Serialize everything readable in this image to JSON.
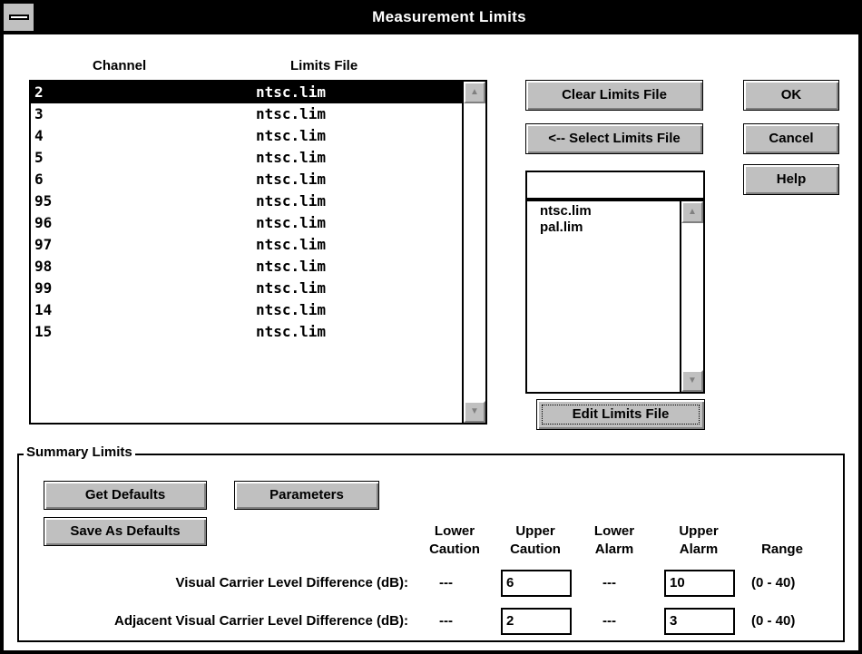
{
  "window": {
    "title": "Measurement Limits"
  },
  "channel_list": {
    "headers": {
      "channel": "Channel",
      "limits_file": "Limits File"
    },
    "rows": [
      {
        "channel": "2",
        "limits_file": "ntsc.lim",
        "selected": true
      },
      {
        "channel": "3",
        "limits_file": "ntsc.lim"
      },
      {
        "channel": "4",
        "limits_file": "ntsc.lim"
      },
      {
        "channel": "5",
        "limits_file": "ntsc.lim"
      },
      {
        "channel": "6",
        "limits_file": "ntsc.lim"
      },
      {
        "channel": "95",
        "limits_file": "ntsc.lim"
      },
      {
        "channel": "96",
        "limits_file": "ntsc.lim"
      },
      {
        "channel": "97",
        "limits_file": "ntsc.lim"
      },
      {
        "channel": "98",
        "limits_file": "ntsc.lim"
      },
      {
        "channel": "99",
        "limits_file": "ntsc.lim"
      },
      {
        "channel": "14",
        "limits_file": "ntsc.lim"
      },
      {
        "channel": "15",
        "limits_file": "ntsc.lim"
      }
    ]
  },
  "buttons": {
    "clear_limits_file": "Clear Limits File",
    "select_limits_file": "<-- Select Limits File",
    "edit_limits_file": "Edit Limits File",
    "ok": "OK",
    "cancel": "Cancel",
    "help": "Help",
    "get_defaults": "Get Defaults",
    "parameters": "Parameters",
    "save_as_defaults": "Save As Defaults"
  },
  "file_filter": {
    "value": ""
  },
  "file_list": [
    "ntsc.lim",
    "pal.lim"
  ],
  "summary": {
    "group_label": "Summary Limits",
    "columns": {
      "lower_caution": [
        "Lower",
        "Caution"
      ],
      "upper_caution": [
        "Upper",
        "Caution"
      ],
      "lower_alarm": [
        "Lower",
        "Alarm"
      ],
      "upper_alarm": [
        "Upper",
        "Alarm"
      ],
      "range": "Range"
    },
    "rows": [
      {
        "label": "Visual Carrier Level Difference (dB):",
        "lower_caution": "---",
        "upper_caution": "6",
        "lower_alarm": "---",
        "upper_alarm": "10",
        "range": "(0 - 40)"
      },
      {
        "label": "Adjacent Visual Carrier Level Difference (dB):",
        "lower_caution": "---",
        "upper_caution": "2",
        "lower_alarm": "---",
        "upper_alarm": "3",
        "range": "(0 - 40)"
      }
    ]
  },
  "icons": {
    "system_menu": "system-menu-icon",
    "scroll_up": "arrow-up-icon",
    "scroll_down": "arrow-down-icon"
  }
}
